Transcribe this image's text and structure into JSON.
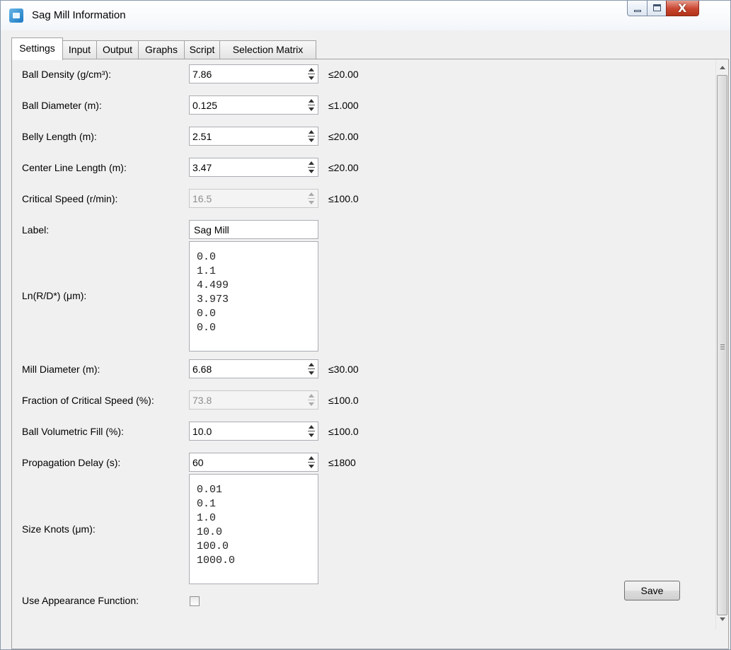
{
  "window": {
    "title": "Sag Mill Information",
    "icon": "app-icon",
    "controls": [
      "minimize-icon",
      "maximize-icon",
      "close-icon"
    ],
    "close_label": "X"
  },
  "tabs": [
    {
      "label": "Settings",
      "active": true
    },
    {
      "label": "Input",
      "active": false
    },
    {
      "label": "Output",
      "active": false
    },
    {
      "label": "Graphs",
      "active": false
    },
    {
      "label": "Script",
      "active": false
    },
    {
      "label": "Selection Matrix",
      "active": false
    }
  ],
  "settings": {
    "ball_density": {
      "label": "Ball Density (g/cm³):",
      "value": "7.86",
      "limit": "≤20.00",
      "enabled": true
    },
    "ball_diameter": {
      "label": "Ball Diameter (m):",
      "value": "0.125",
      "limit": "≤1.000",
      "enabled": true
    },
    "belly_length": {
      "label": "Belly Length (m):",
      "value": "2.51",
      "limit": "≤20.00",
      "enabled": true
    },
    "center_line_length": {
      "label": "Center Line Length (m):",
      "value": "3.47",
      "limit": "≤20.00",
      "enabled": true
    },
    "critical_speed": {
      "label": "Critical Speed (r/min):",
      "value": "16.5",
      "limit": "≤100.0",
      "enabled": false
    },
    "label": {
      "label": "Label:",
      "value": "Sag Mill"
    },
    "ln_rd": {
      "label": "Ln(R/D*) (μm):",
      "values": [
        "0.0",
        "1.1",
        "4.499",
        "3.973",
        "0.0",
        "0.0"
      ]
    },
    "mill_diameter": {
      "label": "Mill Diameter (m):",
      "value": "6.68",
      "limit": "≤30.00",
      "enabled": true
    },
    "fraction_critical_speed": {
      "label": "Fraction of Critical Speed (%):",
      "value": "73.8",
      "limit": "≤100.0",
      "enabled": false
    },
    "ball_volumetric_fill": {
      "label": "Ball Volumetric Fill (%):",
      "value": "10.0",
      "limit": "≤100.0",
      "enabled": true
    },
    "propagation_delay": {
      "label": "Propagation Delay (s):",
      "value": "60",
      "limit": "≤1800",
      "enabled": true
    },
    "size_knots": {
      "label": "Size Knots (μm):",
      "values": [
        "0.01",
        "0.1",
        "1.0",
        "10.0",
        "100.0",
        "1000.0"
      ]
    },
    "use_appearance_function": {
      "label": "Use Appearance Function:",
      "checked": false
    }
  },
  "footer": {
    "save_label": "Save"
  }
}
